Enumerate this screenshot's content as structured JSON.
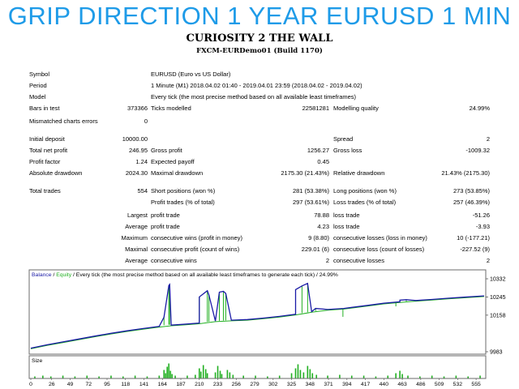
{
  "banner": "GRIP DIRECTION 1 YEAR EURUSD 1 MIN",
  "report": {
    "title": "CURIOSITY 2 THE WALL",
    "subtitle": "FXCM-EURDemo01 (Build 1170)",
    "symbol_label": "Symbol",
    "symbol_value": "EURUSD (Euro vs US Dollar)",
    "period_label": "Period",
    "period_value": "1 Minute (M1) 2018.04.02 01:40 - 2019.04.01 23:59 (2018.04.02 - 2019.04.02)",
    "model_label": "Model",
    "model_value": "Every tick (the most precise method based on all available least timeframes)",
    "bars_label": "Bars in test",
    "bars_value": "373366",
    "ticks_label": "Ticks modelled",
    "ticks_value": "22581281",
    "quality_label": "Modelling quality",
    "quality_value": "24.99%",
    "mismatch_label": "Mismatched charts errors",
    "mismatch_value": "0",
    "deposit_label": "Initial deposit",
    "deposit_value": "10000.00",
    "spread_label": "Spread",
    "spread_value": "2",
    "netprofit_label": "Total net profit",
    "netprofit_value": "246.95",
    "grossprofit_label": "Gross profit",
    "grossprofit_value": "1256.27",
    "grossloss_label": "Gross loss",
    "grossloss_value": "-1009.32",
    "pf_label": "Profit factor",
    "pf_value": "1.24",
    "expected_label": "Expected payoff",
    "expected_value": "0.45",
    "absdd_label": "Absolute drawdown",
    "absdd_value": "2024.30",
    "maxdd_label": "Maximal drawdown",
    "maxdd_value": "2175.30 (21.43%)",
    "reldd_label": "Relative drawdown",
    "reldd_value": "21.43% (2175.30)",
    "trades_label": "Total trades",
    "trades_value": "554",
    "short_label": "Short positions (won %)",
    "short_value": "281 (53.38%)",
    "long_label": "Long positions (won %)",
    "long_value": "273 (53.85%)",
    "profittrades_label": "Profit trades (% of total)",
    "profittrades_value": "297 (53.61%)",
    "losstrades_label": "Loss trades (% of total)",
    "losstrades_value": "257 (46.39%)",
    "largest_label": "Largest",
    "largest_profit_label": "profit trade",
    "largest_profit_value": "78.88",
    "largest_loss_label": "loss trade",
    "largest_loss_value": "-51.26",
    "average_label": "Average",
    "average_profit_label": "profit trade",
    "average_profit_value": "4.23",
    "average_loss_label": "loss trade",
    "average_loss_value": "-3.93",
    "maximum_label": "Maximum",
    "max_wins_label": "consecutive wins (profit in money)",
    "max_wins_value": "9 (8.80)",
    "max_losses_label": "consecutive losses (loss in money)",
    "max_losses_value": "10 (-177.21)",
    "maximal_label": "Maximal",
    "maximal_profit_label": "consecutive profit (count of wins)",
    "maximal_profit_value": "229.01 (6)",
    "maximal_loss_label": "consecutive loss (count of losses)",
    "maximal_loss_value": "-227.52 (9)",
    "average2_label": "Average",
    "avg_wins_label": "consecutive wins",
    "avg_wins_value": "2",
    "avg_losses_label": "consecutive losses",
    "avg_losses_value": "2"
  },
  "chart_data": {
    "type": "line",
    "legend_balance": "Balance",
    "legend_sep": " / ",
    "legend_equity": "Equity",
    "legend_rest": " / Every tick (the most precise method based on all available least timeframes to generate each tick) / 24.99%",
    "balance_color": "#1a1aa6",
    "equity_color": "#22b022",
    "y_ticks": [
      "10332",
      "10245",
      "10158",
      "9983"
    ],
    "y_tick_values": [
      10332,
      10245,
      10158,
      9983
    ],
    "ylim": [
      9983,
      10332
    ],
    "size_label": "Size",
    "x_ticks": [
      "0",
      "26",
      "49",
      "72",
      "95",
      "118",
      "141",
      "164",
      "187",
      "210",
      "233",
      "256",
      "279",
      "302",
      "325",
      "348",
      "371",
      "394",
      "417",
      "440",
      "463",
      "486",
      "509",
      "532",
      "555"
    ],
    "x_max": 565,
    "balance": [
      [
        0,
        10000
      ],
      [
        20,
        10016
      ],
      [
        40,
        10030
      ],
      [
        60,
        10044
      ],
      [
        80,
        10058
      ],
      [
        100,
        10071
      ],
      [
        120,
        10083
      ],
      [
        140,
        10094
      ],
      [
        160,
        10104
      ],
      [
        175,
        10110
      ],
      [
        190,
        10114
      ],
      [
        210,
        10120
      ],
      [
        230,
        10130
      ],
      [
        250,
        10134
      ],
      [
        270,
        10137
      ],
      [
        290,
        10144
      ],
      [
        310,
        10152
      ],
      [
        330,
        10162
      ],
      [
        350,
        10175
      ],
      [
        370,
        10185
      ],
      [
        390,
        10190
      ],
      [
        400,
        10195
      ],
      [
        420,
        10205
      ],
      [
        440,
        10215
      ],
      [
        460,
        10222
      ],
      [
        480,
        10228
      ],
      [
        500,
        10233
      ],
      [
        520,
        10239
      ],
      [
        540,
        10244
      ],
      [
        565,
        10250
      ]
    ],
    "equity_spikes": [
      [
        166,
        10110,
        10148
      ],
      [
        172,
        10112,
        10300
      ],
      [
        173,
        10112,
        10305
      ],
      [
        210,
        10122,
        10245
      ],
      [
        220,
        10126,
        10275
      ],
      [
        222,
        10127,
        10255
      ],
      [
        235,
        10131,
        10268
      ],
      [
        240,
        10132,
        10272
      ],
      [
        243,
        10133,
        10262
      ],
      [
        330,
        10162,
        10280
      ],
      [
        338,
        10168,
        10298
      ],
      [
        345,
        10172,
        10310
      ],
      [
        355,
        10178,
        10190
      ],
      [
        389,
        10190,
        10150
      ],
      [
        455,
        10221,
        10200
      ],
      [
        460,
        10222,
        10230
      ],
      [
        468,
        10224,
        10232
      ]
    ],
    "size_bars": [
      [
        5,
        2
      ],
      [
        15,
        3
      ],
      [
        25,
        2
      ],
      [
        40,
        3
      ],
      [
        55,
        2
      ],
      [
        70,
        3
      ],
      [
        85,
        2
      ],
      [
        100,
        3
      ],
      [
        115,
        2
      ],
      [
        130,
        3
      ],
      [
        145,
        2
      ],
      [
        160,
        3
      ],
      [
        166,
        10
      ],
      [
        168,
        6
      ],
      [
        170,
        14
      ],
      [
        172,
        18
      ],
      [
        174,
        9
      ],
      [
        176,
        5
      ],
      [
        180,
        3
      ],
      [
        195,
        3
      ],
      [
        205,
        4
      ],
      [
        210,
        12
      ],
      [
        212,
        8
      ],
      [
        215,
        16
      ],
      [
        218,
        11
      ],
      [
        220,
        6
      ],
      [
        230,
        7
      ],
      [
        233,
        15
      ],
      [
        236,
        9
      ],
      [
        238,
        5
      ],
      [
        245,
        10
      ],
      [
        248,
        7
      ],
      [
        252,
        4
      ],
      [
        265,
        3
      ],
      [
        280,
        3
      ],
      [
        295,
        2
      ],
      [
        310,
        3
      ],
      [
        325,
        6
      ],
      [
        330,
        12
      ],
      [
        333,
        17
      ],
      [
        336,
        10
      ],
      [
        340,
        7
      ],
      [
        345,
        15
      ],
      [
        348,
        11
      ],
      [
        351,
        6
      ],
      [
        356,
        4
      ],
      [
        370,
        3
      ],
      [
        385,
        4
      ],
      [
        400,
        3
      ],
      [
        415,
        3
      ],
      [
        430,
        2
      ],
      [
        445,
        3
      ],
      [
        455,
        6
      ],
      [
        460,
        9
      ],
      [
        463,
        5
      ],
      [
        470,
        3
      ],
      [
        485,
        2
      ],
      [
        500,
        3
      ],
      [
        515,
        2
      ],
      [
        530,
        3
      ],
      [
        545,
        2
      ],
      [
        560,
        3
      ]
    ],
    "size_max": 18
  }
}
